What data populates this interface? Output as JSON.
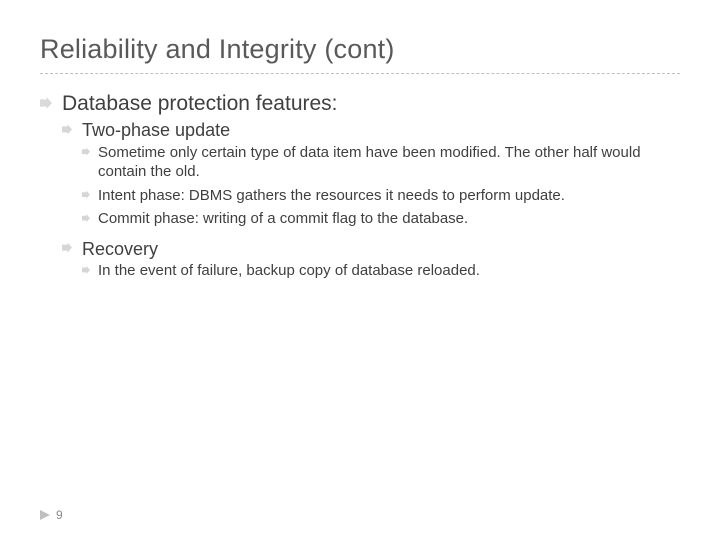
{
  "title": "Reliability and Integrity (cont)",
  "top": {
    "heading": "Database protection features:",
    "sections": [
      {
        "title": "Two-phase update",
        "points": [
          "Sometime only certain type of data item have been modified. The other half would contain the old.",
          "Intent phase: DBMS gathers the resources it needs to perform update.",
          "Commit phase: writing of a commit flag to the database."
        ]
      },
      {
        "title": "Recovery",
        "points": [
          "In the event of failure, backup copy of database reloaded."
        ]
      }
    ]
  },
  "page_number": "9"
}
